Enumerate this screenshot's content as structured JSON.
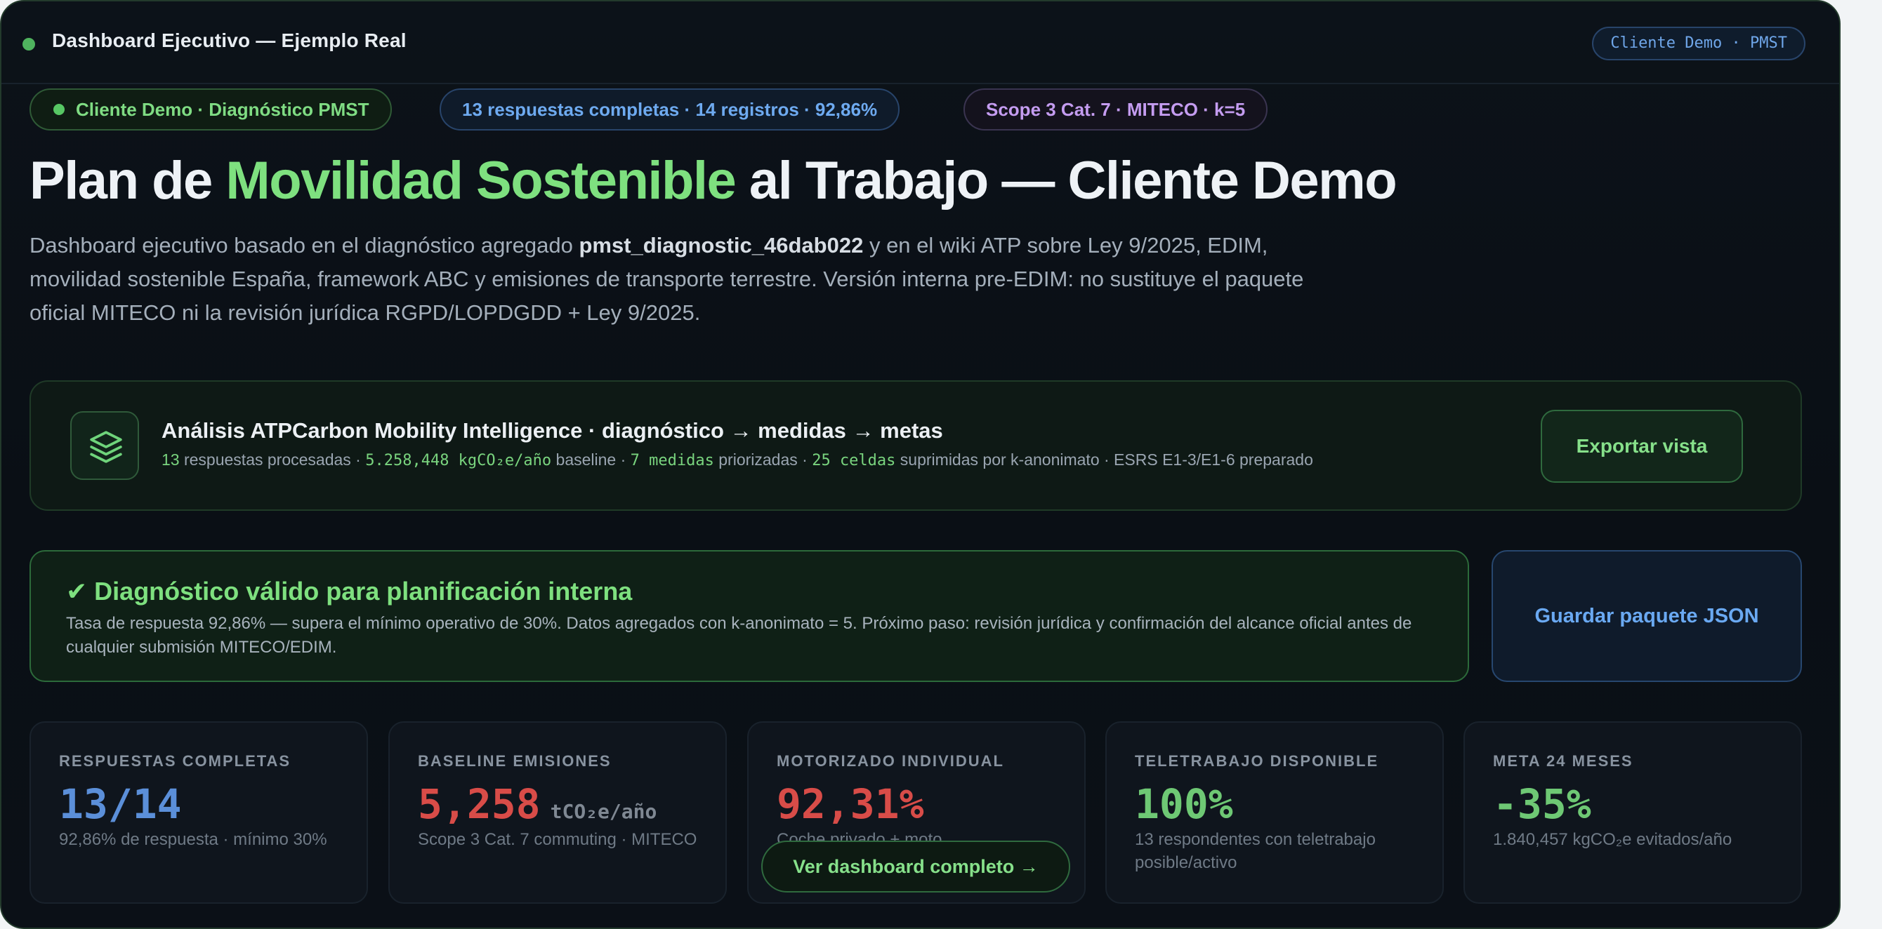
{
  "window": {
    "title": "Dashboard Ejecutivo — Ejemplo Real",
    "badge": "Cliente Demo · PMST"
  },
  "pills": {
    "client": "Cliente Demo · Diagnóstico PMST",
    "responses": "13 respuestas completas · 14 registros · 92,86%",
    "scope": "Scope 3 Cat. 7 · MITECO · k=5"
  },
  "hero": {
    "title_pre": "Plan de ",
    "title_accent": "Movilidad Sostenible",
    "title_post": " al Trabajo — Cliente Demo",
    "desc_pre": "Dashboard ejecutivo basado en el diagnóstico agregado ",
    "desc_id": "pmst_diagnostic_46dab022",
    "desc_post": " y en el wiki ATP sobre Ley 9/2025, EDIM, movilidad sostenible España, framework ABC y emisiones de transporte terrestre. Versión interna pre-EDIM: no sustituye el paquete oficial MITECO ni la revisión jurídica RGPD/LOPDGDD + Ley 9/2025."
  },
  "analysis": {
    "title": "Análisis ATPCarbon Mobility Intelligence · diagnóstico → medidas → metas",
    "n_responses": "13",
    "t_responses": " respuestas procesadas · ",
    "baseline_value": "5.258,448 kgCO₂e/año",
    "t_baseline": " baseline · ",
    "measures_value": "7 medidas",
    "t_measures": " priorizadas · ",
    "cells_value": "25 celdas",
    "t_cells": " suprimidas por k-anonimato · ESRS E1-3/E1-6 preparado",
    "export_label": "Exportar vista"
  },
  "validity": {
    "check": "✔",
    "title": "Diagnóstico válido para planificación interna",
    "desc": "Tasa de respuesta 92,86% — supera el mínimo operativo de 30%. Datos agregados con k-anonimato = 5. Próximo paso: revisión jurídica y confirmación del alcance oficial antes de cualquier submisión MITECO/EDIM.",
    "save_label": "Guardar paquete JSON"
  },
  "kpis": [
    {
      "label": "RESPUESTAS COMPLETAS",
      "value": "13/14",
      "unit": "",
      "note": "92,86% de respuesta · mínimo 30%"
    },
    {
      "label": "BASELINE EMISIONES",
      "value": "5,258",
      "unit": "tCO₂e/año",
      "note": "Scope 3 Cat. 7 commuting · MITECO"
    },
    {
      "label": "MOTORIZADO INDIVIDUAL",
      "value": "92,31%",
      "unit": "",
      "note": "Coche privado + moto"
    },
    {
      "label": "TELETRABAJO DISPONIBLE",
      "value": "100%",
      "unit": "",
      "note": "13 respondentes con teletrabajo posible/activo"
    },
    {
      "label": "META 24 MESES",
      "value": "-35%",
      "unit": "",
      "note": "1.840,457 kgCO₂e evitados/año"
    }
  ],
  "dashboard_button": "Ver dashboard completo →"
}
